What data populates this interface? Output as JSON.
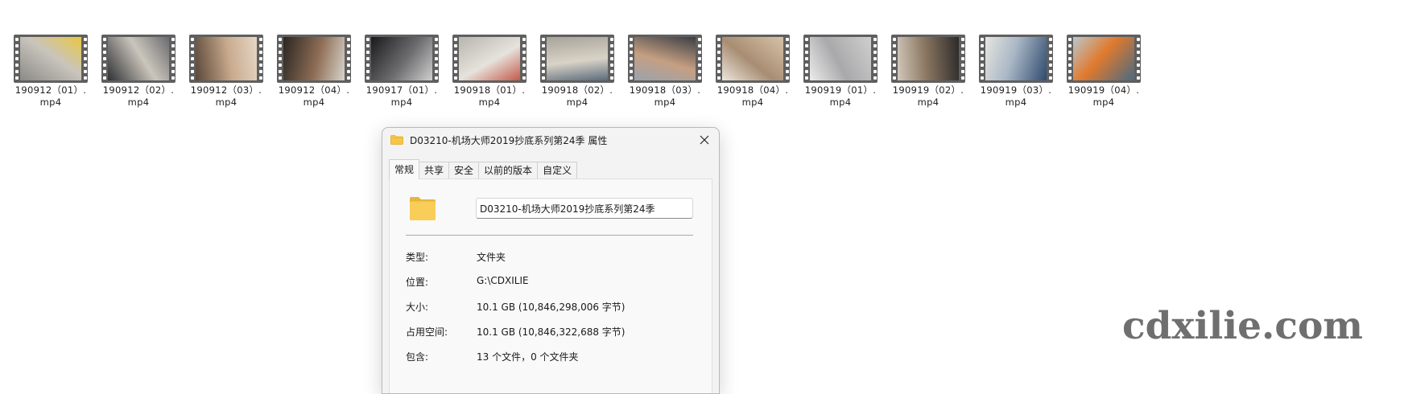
{
  "files": [
    {
      "name_line1": "190912（01）.",
      "name_line2": "mp4",
      "thumb_colors": [
        "#8a8a86",
        "#c9c5bd",
        "#e9c640"
      ]
    },
    {
      "name_line1": "190912（02）.",
      "name_line2": "mp4",
      "thumb_colors": [
        "#2e3034",
        "#cbc6bc",
        "#6b6a70"
      ]
    },
    {
      "name_line1": "190912（03）.",
      "name_line2": "mp4",
      "thumb_colors": [
        "#5a4638",
        "#c9ab8e",
        "#e6d7c6"
      ]
    },
    {
      "name_line1": "190912（04）.",
      "name_line2": "mp4",
      "thumb_colors": [
        "#2a2622",
        "#8e6d55",
        "#d8d4cc"
      ]
    },
    {
      "name_line1": "190917（01）.",
      "name_line2": "mp4",
      "thumb_colors": [
        "#1a1a1c",
        "#6d6d70",
        "#cfcfcf"
      ]
    },
    {
      "name_line1": "190918（01）.",
      "name_line2": "mp4",
      "thumb_colors": [
        "#b8b4ae",
        "#e6e2dc",
        "#c45a4a"
      ]
    },
    {
      "name_line1": "190918（02）.",
      "name_line2": "mp4",
      "thumb_colors": [
        "#a7a39b",
        "#d9d3c7",
        "#5b6b7a"
      ]
    },
    {
      "name_line1": "190918（03）.",
      "name_line2": "mp4",
      "thumb_colors": [
        "#3a3e44",
        "#c59f82",
        "#9aa3ad"
      ]
    },
    {
      "name_line1": "190918（04）.",
      "name_line2": "mp4",
      "thumb_colors": [
        "#d7c2a7",
        "#a88d73",
        "#ece6dc"
      ]
    },
    {
      "name_line1": "190919（01）.",
      "name_line2": "mp4",
      "thumb_colors": [
        "#cfcfcf",
        "#a9a9ab",
        "#ececec"
      ]
    },
    {
      "name_line1": "190919（02）.",
      "name_line2": "mp4",
      "thumb_colors": [
        "#2c2a2a",
        "#8c7862",
        "#d2c8bc"
      ]
    },
    {
      "name_line1": "190919（03）.",
      "name_line2": "mp4",
      "thumb_colors": [
        "#2f4b6e",
        "#a9b7c6",
        "#e7e5df"
      ]
    },
    {
      "name_line1": "190919（04）.",
      "name_line2": "mp4",
      "thumb_colors": [
        "#4a6a82",
        "#e07a2e",
        "#bcc6cc"
      ]
    }
  ],
  "dialog": {
    "title": "D03210-机场大师2019抄底系列第24季 属性",
    "tabs": [
      {
        "label": "常规",
        "active": true
      },
      {
        "label": "共享",
        "active": false
      },
      {
        "label": "安全",
        "active": false
      },
      {
        "label": "以前的版本",
        "active": false
      },
      {
        "label": "自定义",
        "active": false
      }
    ],
    "folder_name": "D03210-机场大师2019抄底系列第24季",
    "properties": [
      {
        "label": "类型:",
        "value": "文件夹"
      },
      {
        "label": "位置:",
        "value": "G:\\CDXILIE"
      },
      {
        "label": "大小:",
        "value": "10.1 GB (10,846,298,006 字节)"
      },
      {
        "label": "占用空间:",
        "value": "10.1 GB (10,846,322,688 字节)"
      },
      {
        "label": "包含:",
        "value": "13 个文件，0 个文件夹"
      }
    ]
  },
  "watermark": "cdxilie.com",
  "colors": {
    "folder_yellow": "#f6c744",
    "folder_yellow_dark": "#e2a929",
    "film_strip": "#5f5f5f",
    "dialog_bg": "#f3f3f3"
  }
}
